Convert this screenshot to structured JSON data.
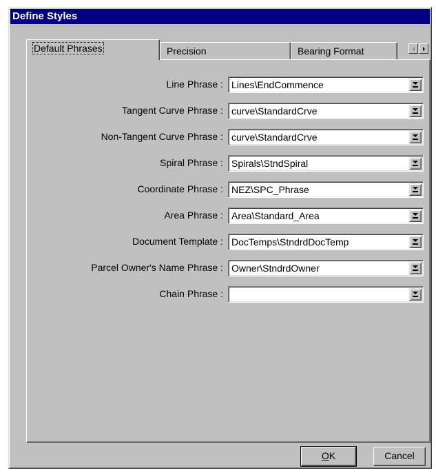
{
  "window": {
    "title": "Define Styles"
  },
  "tabs": [
    {
      "label": "Default Phrases",
      "active": true
    },
    {
      "label": "Precision",
      "active": false
    },
    {
      "label": "Bearing Format",
      "active": false
    }
  ],
  "fields": [
    {
      "label": "Line Phrase :",
      "value": "Lines\\EndCommence"
    },
    {
      "label": "Tangent Curve Phrase :",
      "value": "curve\\StandardCrve"
    },
    {
      "label": "Non-Tangent Curve Phrase :",
      "value": "curve\\StandardCrve"
    },
    {
      "label": "Spiral Phrase :",
      "value": "Spirals\\StndSpiral"
    },
    {
      "label": "Coordinate Phrase :",
      "value": "NEZ\\SPC_Phrase"
    },
    {
      "label": "Area Phrase :",
      "value": "Area\\Standard_Area"
    },
    {
      "label": "Document Template :",
      "value": "DocTemps\\StndrdDocTemp"
    },
    {
      "label": "Parcel Owner's Name Phrase :",
      "value": "Owner\\StndrdOwner"
    },
    {
      "label": "Chain Phrase :",
      "value": ""
    }
  ],
  "buttons": {
    "ok_mnemonic": "O",
    "ok_rest": "K",
    "cancel": "Cancel"
  },
  "icons": {
    "dropdown": "chevron-down-icon",
    "tab_scroll_left": "arrow-left-icon",
    "tab_scroll_right": "arrow-right-icon"
  }
}
